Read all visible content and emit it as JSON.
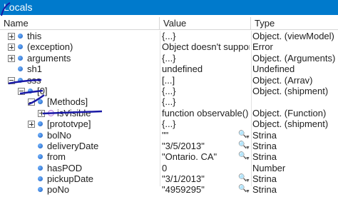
{
  "panel": {
    "title": "Locals"
  },
  "columns": {
    "name": "Name",
    "value": "Value",
    "type": "Type"
  },
  "rows": [
    {
      "name": "this",
      "value": "{...}",
      "type": "Object. (viewModel)"
    },
    {
      "name": "(exception)",
      "value": "Object doesn't suppor",
      "type": "Error"
    },
    {
      "name": "arguments",
      "value": "{...}",
      "type": "Object. (Arguments)"
    },
    {
      "name": "sh1",
      "value": "undefined",
      "type": "Undefined"
    },
    {
      "name": "sss",
      "value": "[...]",
      "type": "Object. (Arrav)"
    },
    {
      "name": "[0]",
      "value": "{...}",
      "type": "Object. (shipment)"
    },
    {
      "name": "[Methods]",
      "value": "{...}",
      "type": ""
    },
    {
      "name": "isVisible",
      "value": "function observable() {",
      "type": "Object. (Function)"
    },
    {
      "name": "[prototvpe]",
      "value": "{...}",
      "type": "Object. (shipment)"
    },
    {
      "name": "bolNo",
      "value": "\"\"",
      "type": "Strina"
    },
    {
      "name": "deliveryDate",
      "value": "\"3/5/2013\"",
      "type": "Strina"
    },
    {
      "name": "from",
      "value": "\"Ontario. CA\"",
      "type": "Strina"
    },
    {
      "name": "hasPOD",
      "value": "0",
      "type": "Number"
    },
    {
      "name": "pickupDate",
      "value": "\"3/1/2013\"",
      "type": "Strina"
    },
    {
      "name": "poNo",
      "value": "\"4959295\"",
      "type": "Strina"
    }
  ],
  "icons": {
    "expander_collapsed": "plus-box",
    "expander_expanded": "minus-box",
    "object": "blue-sphere",
    "method": "purple-method",
    "visualizer": "magnifier"
  },
  "colors": {
    "titlebar": "#007acc",
    "annotation": "#1a1aa6"
  }
}
